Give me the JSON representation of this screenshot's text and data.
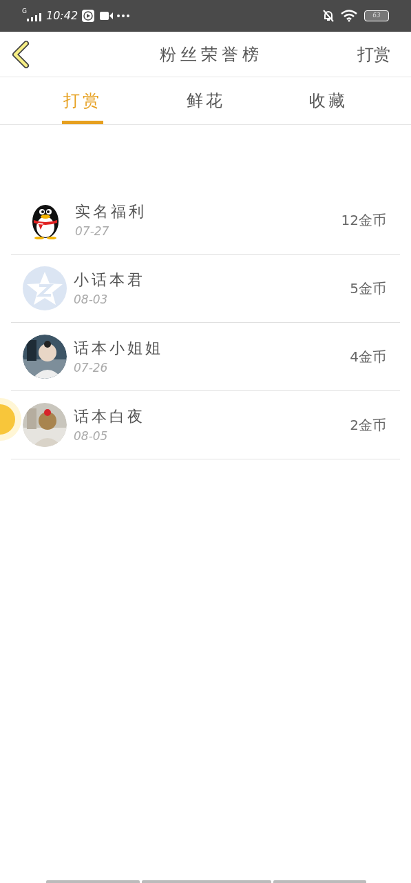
{
  "status_bar": {
    "network": "G",
    "time": "10:42",
    "battery": "63"
  },
  "header": {
    "title": "粉丝荣誉榜",
    "action": "打赏"
  },
  "tabs": [
    {
      "label": "打赏",
      "selected": true
    },
    {
      "label": "鲜花",
      "selected": false
    },
    {
      "label": "收藏",
      "selected": false
    }
  ],
  "rows": [
    {
      "kind": "penguin",
      "name": "实名福利",
      "date": "07-27",
      "amount": "12金币"
    },
    {
      "kind": "star",
      "name": "小话本君",
      "date": "08-03",
      "amount": "5金币"
    },
    {
      "kind": "picture",
      "name": "话本小姐姐",
      "date": "07-26",
      "amount": "4金币"
    },
    {
      "kind": "picture",
      "name": "话本白夜",
      "date": "08-05",
      "amount": "2金币"
    }
  ]
}
